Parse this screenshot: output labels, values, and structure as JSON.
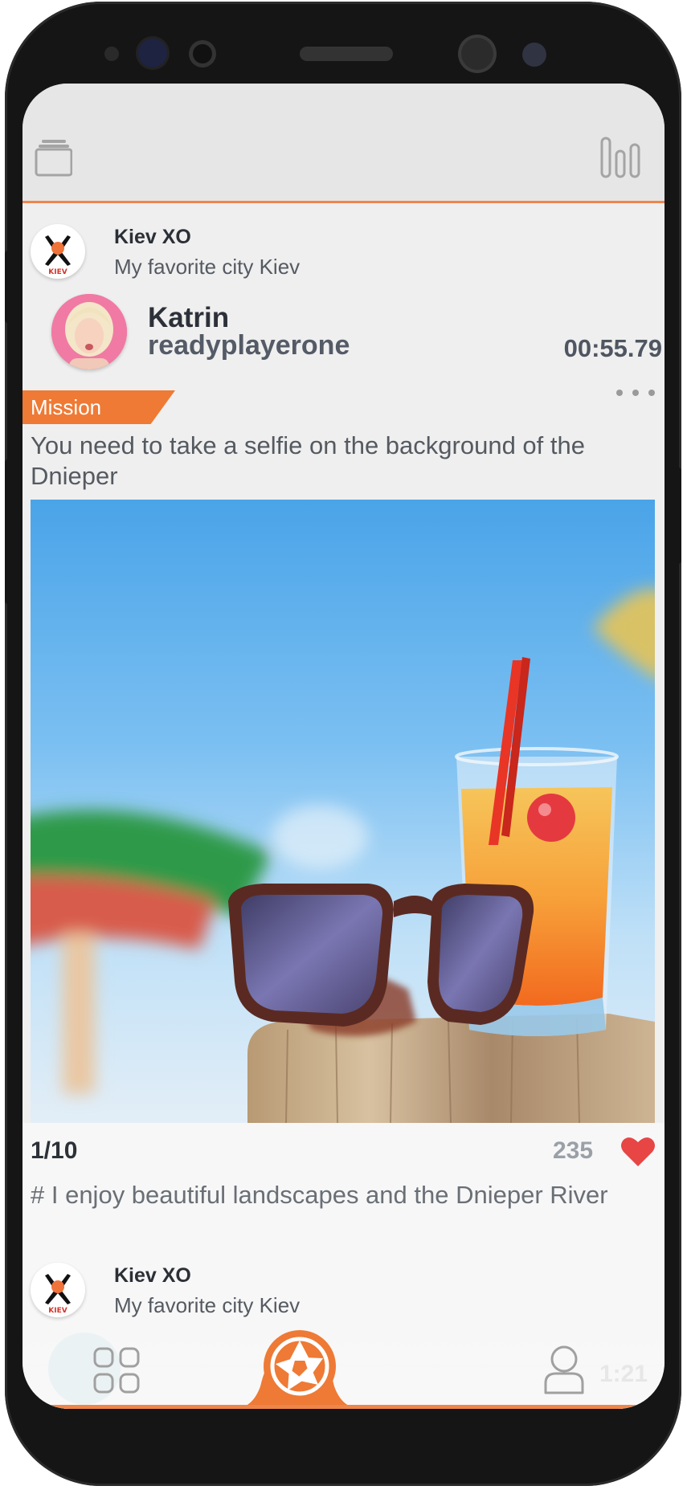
{
  "colors": {
    "accent": "#ee7a35",
    "heart": "#e84545",
    "text_dark": "#2c3039",
    "text_muted": "#555a61"
  },
  "header": {
    "left_icon": "cards-stack-icon",
    "right_icon": "bar-chart-icon"
  },
  "post": {
    "org": {
      "name": "Kiev XO",
      "subtitle": "My favorite city Kiev",
      "logo_text": "KIEV"
    },
    "user": {
      "name": "Katrin",
      "handle": "readyplayerone"
    },
    "timer": "00:55.79",
    "mission_label": "Mission",
    "mission_text": "You need to take a selfie on the background of the Dnieper",
    "photo_icon": "photo-sunglasses-cocktail",
    "counter": "1/10",
    "likes": "235",
    "hashtag": "#  I enjoy beautiful landscapes and the Dnieper River"
  },
  "next_post": {
    "org": {
      "name": "Kiev XO",
      "subtitle": "My favorite city Kiev",
      "logo_text": "KIEV"
    }
  },
  "tabbar": {
    "left_icon": "grid-icon",
    "center_icon": "camera-aperture-icon",
    "right_icon": "user-icon",
    "ghost_time": "1:21"
  }
}
